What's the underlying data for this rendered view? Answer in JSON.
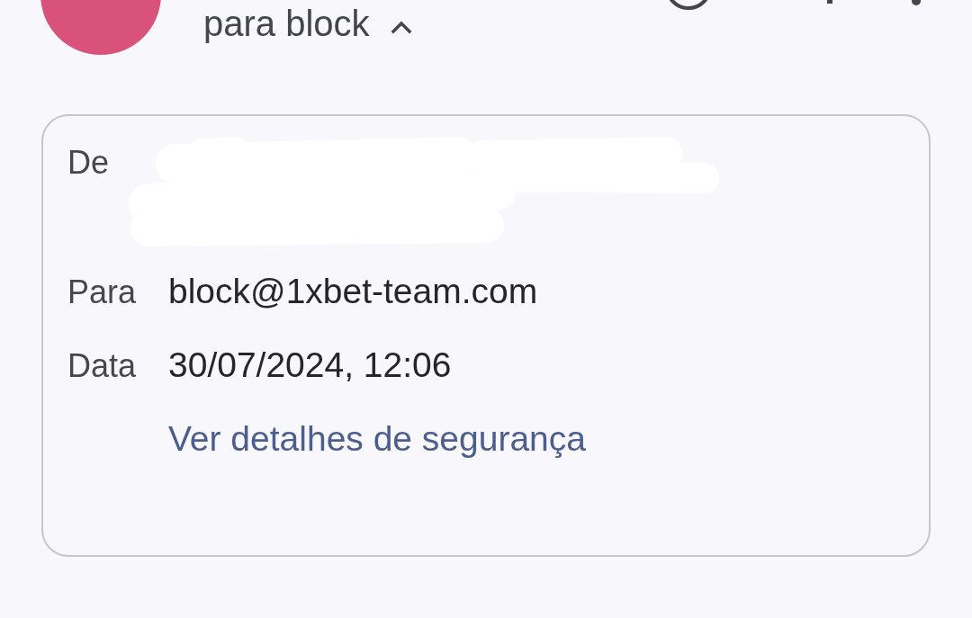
{
  "header": {
    "recipient_summary": "para block",
    "details_expanded": true
  },
  "details": {
    "rows": [
      {
        "label": "De",
        "kind": "redacted"
      },
      {
        "label": "Para",
        "kind": "text",
        "value": "block@1xbet-team.com"
      },
      {
        "label": "Data",
        "kind": "text",
        "value": "30/07/2024, 12:06"
      }
    ],
    "security_link": "Ver detalhes de segurança"
  }
}
